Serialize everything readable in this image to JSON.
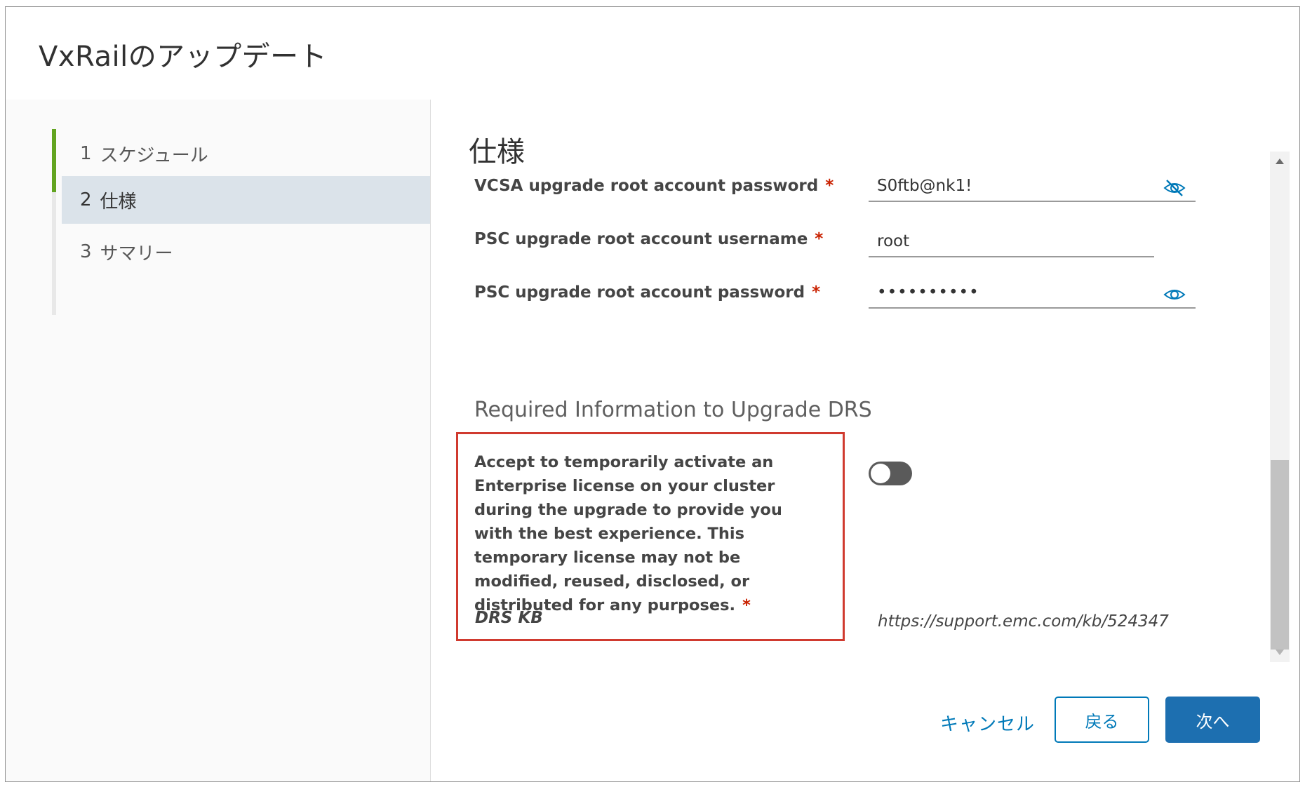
{
  "dialog": {
    "title": "VxRailのアップデート"
  },
  "stepper": {
    "steps": [
      {
        "num": "1",
        "label": "スケジュール"
      },
      {
        "num": "2",
        "label": "仕様"
      },
      {
        "num": "3",
        "label": "サマリー"
      }
    ],
    "active_step": 2
  },
  "content": {
    "section_title": "仕様",
    "fields": [
      {
        "label": "VCSA upgrade root account password",
        "required": "*",
        "value": "S0ftb@nk1!",
        "icon": "eye-slash-icon"
      },
      {
        "label": "PSC upgrade root account username",
        "required": "*",
        "value": "root"
      },
      {
        "label": "PSC upgrade root account password",
        "required": "*",
        "value": "••••••••••",
        "icon": "eye-icon"
      }
    ],
    "drs_section_title": "Required Information to Upgrade DRS",
    "license": {
      "text": "Accept to temporarily activate an Enterprise license on your cluster during the upgrade to provide you with the best experience. This temporary license may not be modified, reused, disclosed, or distributed for any purposes.",
      "required": "*",
      "toggle_state": "off"
    },
    "kb": {
      "label": "DRS KB",
      "url": "https://support.emc.com/kb/524347"
    }
  },
  "footer": {
    "cancel_label": "キャンセル",
    "back_label": "戻る",
    "next_label": "次へ"
  },
  "colors": {
    "accent": "#0079b8",
    "primary_button": "#1d6fb0",
    "active_step_bar": "#62a420",
    "active_step_bg": "#dbe3ea",
    "required": "#c92100",
    "highlight_box": "#d03a2f"
  }
}
